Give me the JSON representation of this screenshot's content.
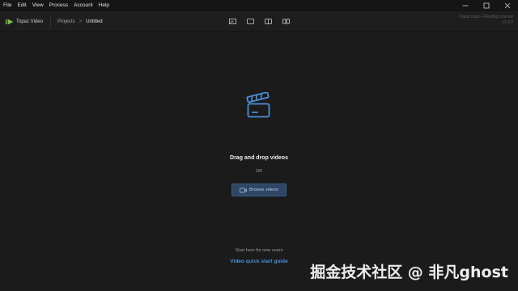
{
  "menubar": {
    "items": [
      "File",
      "Edit",
      "View",
      "Process",
      "Account",
      "Help"
    ]
  },
  "toolbar": {
    "app_name": "Topaz Video",
    "breadcrumb_root": "Projects",
    "breadcrumb_sep": ">",
    "breadcrumb_current": "Untitled",
    "license_line1": "Topaz Labs • Floating License",
    "license_line2": "v1.0.0"
  },
  "main": {
    "drop_title": "Drag and drop videos",
    "or_text": "OR",
    "browse_label": "Browse videos",
    "start_hint": "Start here for new users",
    "guide_link": "Video quick start guide"
  },
  "watermark": "掘金技术社区 @ 非凡ghost",
  "colors": {
    "background": "#1b1b1b",
    "accent": "#4a90d9",
    "button_bg": "#2d4663",
    "logo_green": "#7ac142"
  }
}
